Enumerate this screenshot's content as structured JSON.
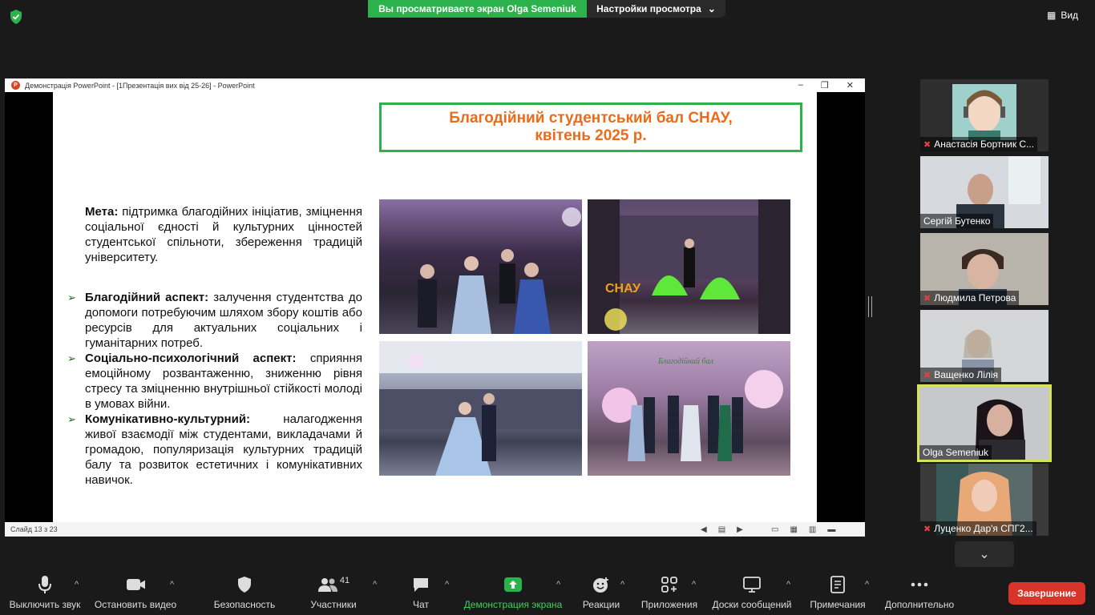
{
  "zoom": {
    "share_banner": "Вы просматриваете экран Olga Semeniuk",
    "view_options": "Настройки просмотра",
    "view_button": "Вид",
    "end_button": "Завершение",
    "participants_count": "41"
  },
  "ppt": {
    "window_title": "Демонстрація PowerPoint - [1Презентація вих від 25-26] - PowerPoint",
    "status_slide": "Слайд 13 з 23"
  },
  "slide": {
    "title_line1": "Благодійний студентський бал СНАУ,",
    "title_line2": "квітень 2025 р.",
    "goal_label": "Мета:",
    "goal_text": " підтримка благодійних ініціатив, зміцнення соціальної єдності й культурних цінностей студентської спільноти, збереження традицій університету.",
    "bullets": [
      {
        "label": "Благодійний аспект:",
        "text": " залучення студентства до допомоги потребуючим шляхом збору коштів або ресурсів для актуальних соціальних і гуманітарних потреб."
      },
      {
        "label": "Соціально-психологічний аспект:",
        "text": " сприяння емоційному розвантаженню, зниженню рівня стресу та зміцненню внутрішньої стійкості молоді в умовах війни."
      },
      {
        "label": "Комунікативно-культурний:",
        "text": "  налагодження живої взаємодії між студентами, викладачами й громадою, популяризація культурних традицій балу та розвиток естетичних і комунікативних навичок."
      }
    ]
  },
  "participants": [
    {
      "name": "Анастасія Бортник С...",
      "muted": true
    },
    {
      "name": "Сергій Бутенко",
      "muted": false
    },
    {
      "name": "Людмила Петрова",
      "muted": true
    },
    {
      "name": "Ващенко Лілія",
      "muted": true
    },
    {
      "name": "Olga Semeniuk",
      "muted": false
    },
    {
      "name": "Луценко Дар'я СПГ2...",
      "muted": true
    }
  ],
  "toolbar": {
    "mute": "Выключить звук",
    "video": "Остановить видео",
    "security": "Безопасность",
    "participants": "Участники",
    "chat": "Чат",
    "share": "Демонстрация экрана",
    "reactions": "Реакции",
    "apps": "Приложения",
    "whiteboards": "Доски сообщений",
    "notes": "Примечания",
    "more": "Дополнительно"
  },
  "colors": {
    "accent_green": "#2bb24c",
    "title_orange": "#ec6b1a",
    "end_red": "#d9342b",
    "active_speaker": "#d6e25a"
  }
}
